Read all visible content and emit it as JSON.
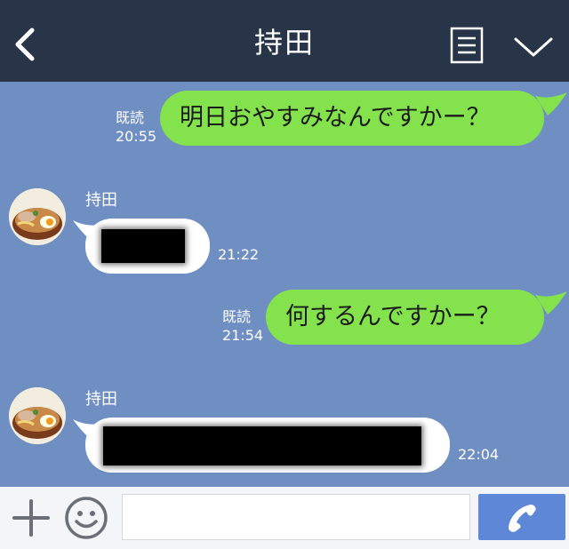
{
  "header": {
    "back_icon": "chevron-left-icon",
    "title": "持田",
    "menu_icon": "menu-icon",
    "dropdown_icon": "chevron-down-icon"
  },
  "colors": {
    "header_bg": "#283548",
    "chat_bg": "#6f8fc3",
    "outgoing_bubble": "#84e34c",
    "incoming_bubble": "#ffffff",
    "call_button": "#5f87d8"
  },
  "messages": [
    {
      "direction": "out",
      "read_label": "既読",
      "time": "20:55",
      "text": "明日おやすみなんですかー？"
    },
    {
      "direction": "in",
      "sender": "持田",
      "time": "21:22",
      "redacted": true
    },
    {
      "direction": "out",
      "read_label": "既読",
      "time": "21:54",
      "text": "何するんですかー？"
    },
    {
      "direction": "in",
      "sender": "持田",
      "time": "22:04",
      "redacted": true
    }
  ],
  "footer": {
    "plus_icon": "plus-icon",
    "emoji_icon": "smiley-icon",
    "input_value": "",
    "call_icon": "phone-icon"
  }
}
